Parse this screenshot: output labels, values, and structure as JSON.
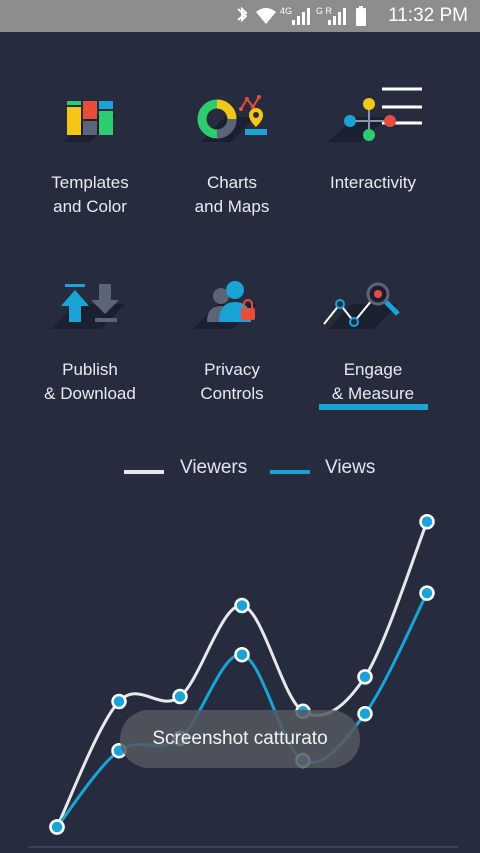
{
  "status": {
    "time": "11:32 PM",
    "network1": "4G",
    "network2": "G R"
  },
  "features": [
    {
      "line1": "Templates",
      "line2": "and Color"
    },
    {
      "line1": "Charts",
      "line2": "and Maps"
    },
    {
      "line1": "Interactivity",
      "line2": ""
    },
    {
      "line1": "Publish",
      "line2": "& Download"
    },
    {
      "line1": "Privacy",
      "line2": "Controls"
    },
    {
      "line1": "Engage",
      "line2": "& Measure"
    }
  ],
  "active_feature": "Engage & Measure",
  "toast": "Screenshot catturato",
  "colors": {
    "background": "#262c3e",
    "viewers": "#e8e8e8",
    "views": "#1aa3d6"
  },
  "chart_data": {
    "type": "line",
    "x": [
      1,
      2,
      3,
      4,
      5,
      6,
      7
    ],
    "series": [
      {
        "name": "Viewers",
        "values": [
          0,
          0.51,
          0.53,
          0.9,
          0.47,
          0.61,
          1.24
        ]
      },
      {
        "name": "Views",
        "values": [
          0,
          0.31,
          0.36,
          0.7,
          0.27,
          0.46,
          0.95
        ]
      }
    ],
    "ylim": [
      0,
      1.3
    ],
    "grid": false,
    "legend": "top-center"
  }
}
